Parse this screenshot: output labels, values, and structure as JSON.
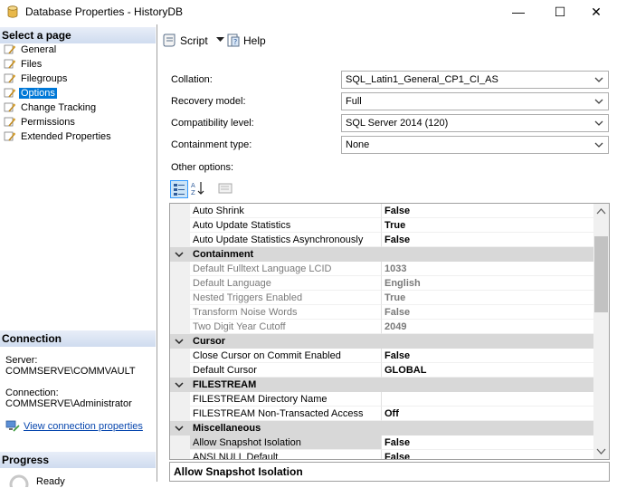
{
  "window": {
    "title": "Database Properties - HistoryDB",
    "minimize": "—",
    "maximize": "☐",
    "close": "✕"
  },
  "left_panel": {
    "select_page_header": "Select a page",
    "pages": [
      {
        "label": "General"
      },
      {
        "label": "Files"
      },
      {
        "label": "Filegroups"
      },
      {
        "label": "Options"
      },
      {
        "label": "Change Tracking"
      },
      {
        "label": "Permissions"
      },
      {
        "label": "Extended Properties"
      }
    ],
    "selected_page": "Options",
    "connection_header": "Connection",
    "server_label": "Server:",
    "server_value": "COMMSERVE\\COMMVAULT",
    "connection_label": "Connection:",
    "connection_value": "COMMSERVE\\Administrator",
    "view_connection_link": "View connection properties",
    "progress_header": "Progress",
    "progress_status": "Ready"
  },
  "toolbar": {
    "script_label": "Script",
    "help_label": "Help"
  },
  "form": {
    "collation_label": "Collation:",
    "collation_value": "SQL_Latin1_General_CP1_CI_AS",
    "recovery_label": "Recovery model:",
    "recovery_value": "Full",
    "compat_label": "Compatibility level:",
    "compat_value": "SQL Server 2014 (120)",
    "containment_label": "Containment type:",
    "containment_value": "None",
    "other_options_label": "Other options:"
  },
  "grid": {
    "rows": [
      {
        "name": "Auto Shrink",
        "value": "False"
      },
      {
        "name": "Auto Update Statistics",
        "value": "True"
      },
      {
        "name": "Auto Update Statistics Asynchronously",
        "value": "False"
      },
      {
        "name": "Containment",
        "value": ""
      },
      {
        "name": "Default Fulltext Language LCID",
        "value": "1033"
      },
      {
        "name": "Default Language",
        "value": "English"
      },
      {
        "name": "Nested Triggers Enabled",
        "value": "True"
      },
      {
        "name": "Transform Noise Words",
        "value": "False"
      },
      {
        "name": "Two Digit Year Cutoff",
        "value": "2049"
      },
      {
        "name": "Cursor",
        "value": ""
      },
      {
        "name": "Close Cursor on Commit Enabled",
        "value": "False"
      },
      {
        "name": "Default Cursor",
        "value": "GLOBAL"
      },
      {
        "name": "FILESTREAM",
        "value": ""
      },
      {
        "name": "FILESTREAM Directory Name",
        "value": ""
      },
      {
        "name": "FILESTREAM Non-Transacted Access",
        "value": "Off"
      },
      {
        "name": "Miscellaneous",
        "value": ""
      },
      {
        "name": "Allow Snapshot Isolation",
        "value": "False"
      },
      {
        "name": "ANSI NULL Default",
        "value": "False"
      }
    ]
  },
  "description": {
    "title": "Allow Snapshot Isolation"
  },
  "colors": {
    "selection": "#0078d7",
    "category_bg": "#d8d8d8",
    "disabled_text": "#7a7a7a",
    "link": "#0645ad"
  }
}
